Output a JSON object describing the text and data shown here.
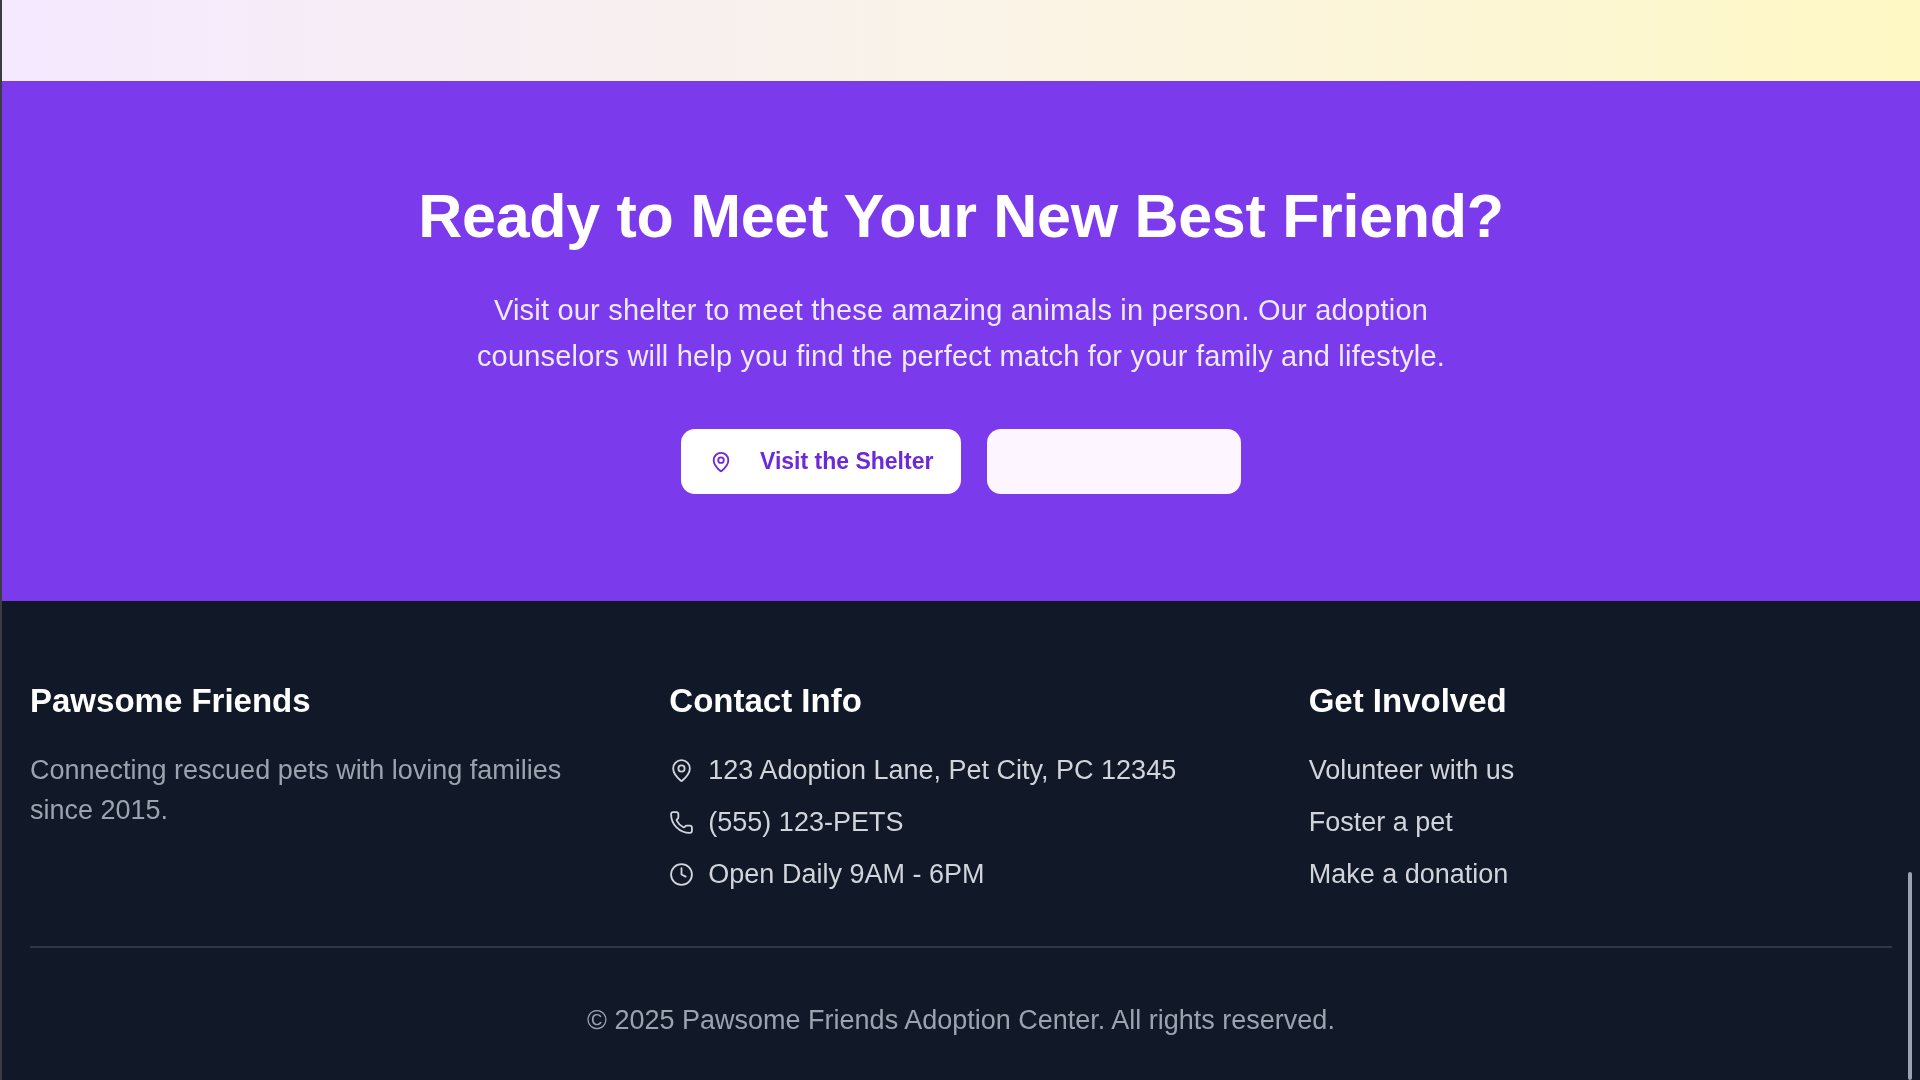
{
  "cta": {
    "heading": "Ready to Meet Your New Best Friend?",
    "text": "Visit our shelter to meet these amazing animals in person. Our adoption counselors will help you find the perfect match for your family and lifestyle.",
    "buttons": [
      {
        "kind": "primary",
        "label": "Visit the Shelter"
      },
      {
        "kind": "blank"
      }
    ]
  },
  "footer": {
    "about": {
      "title": "Pawsome Friends",
      "text": "Connecting rescued pets with loving families since 2015."
    },
    "contact": {
      "title": "Contact Info",
      "items": [
        {
          "kind": "address",
          "text": "123 Adoption Lane, Pet City, PC 12345"
        },
        {
          "kind": "phone",
          "text": "(555) 123-PETS"
        },
        {
          "kind": "hours",
          "text": "Open Daily 9AM - 6PM"
        }
      ]
    },
    "get_involved": {
      "title": "Get Involved",
      "links": [
        "Volunteer with us",
        "Foster a pet",
        "Make a donation"
      ]
    },
    "copyright": "© 2025 Pawsome Friends Adoption Center. All rights reserved."
  }
}
